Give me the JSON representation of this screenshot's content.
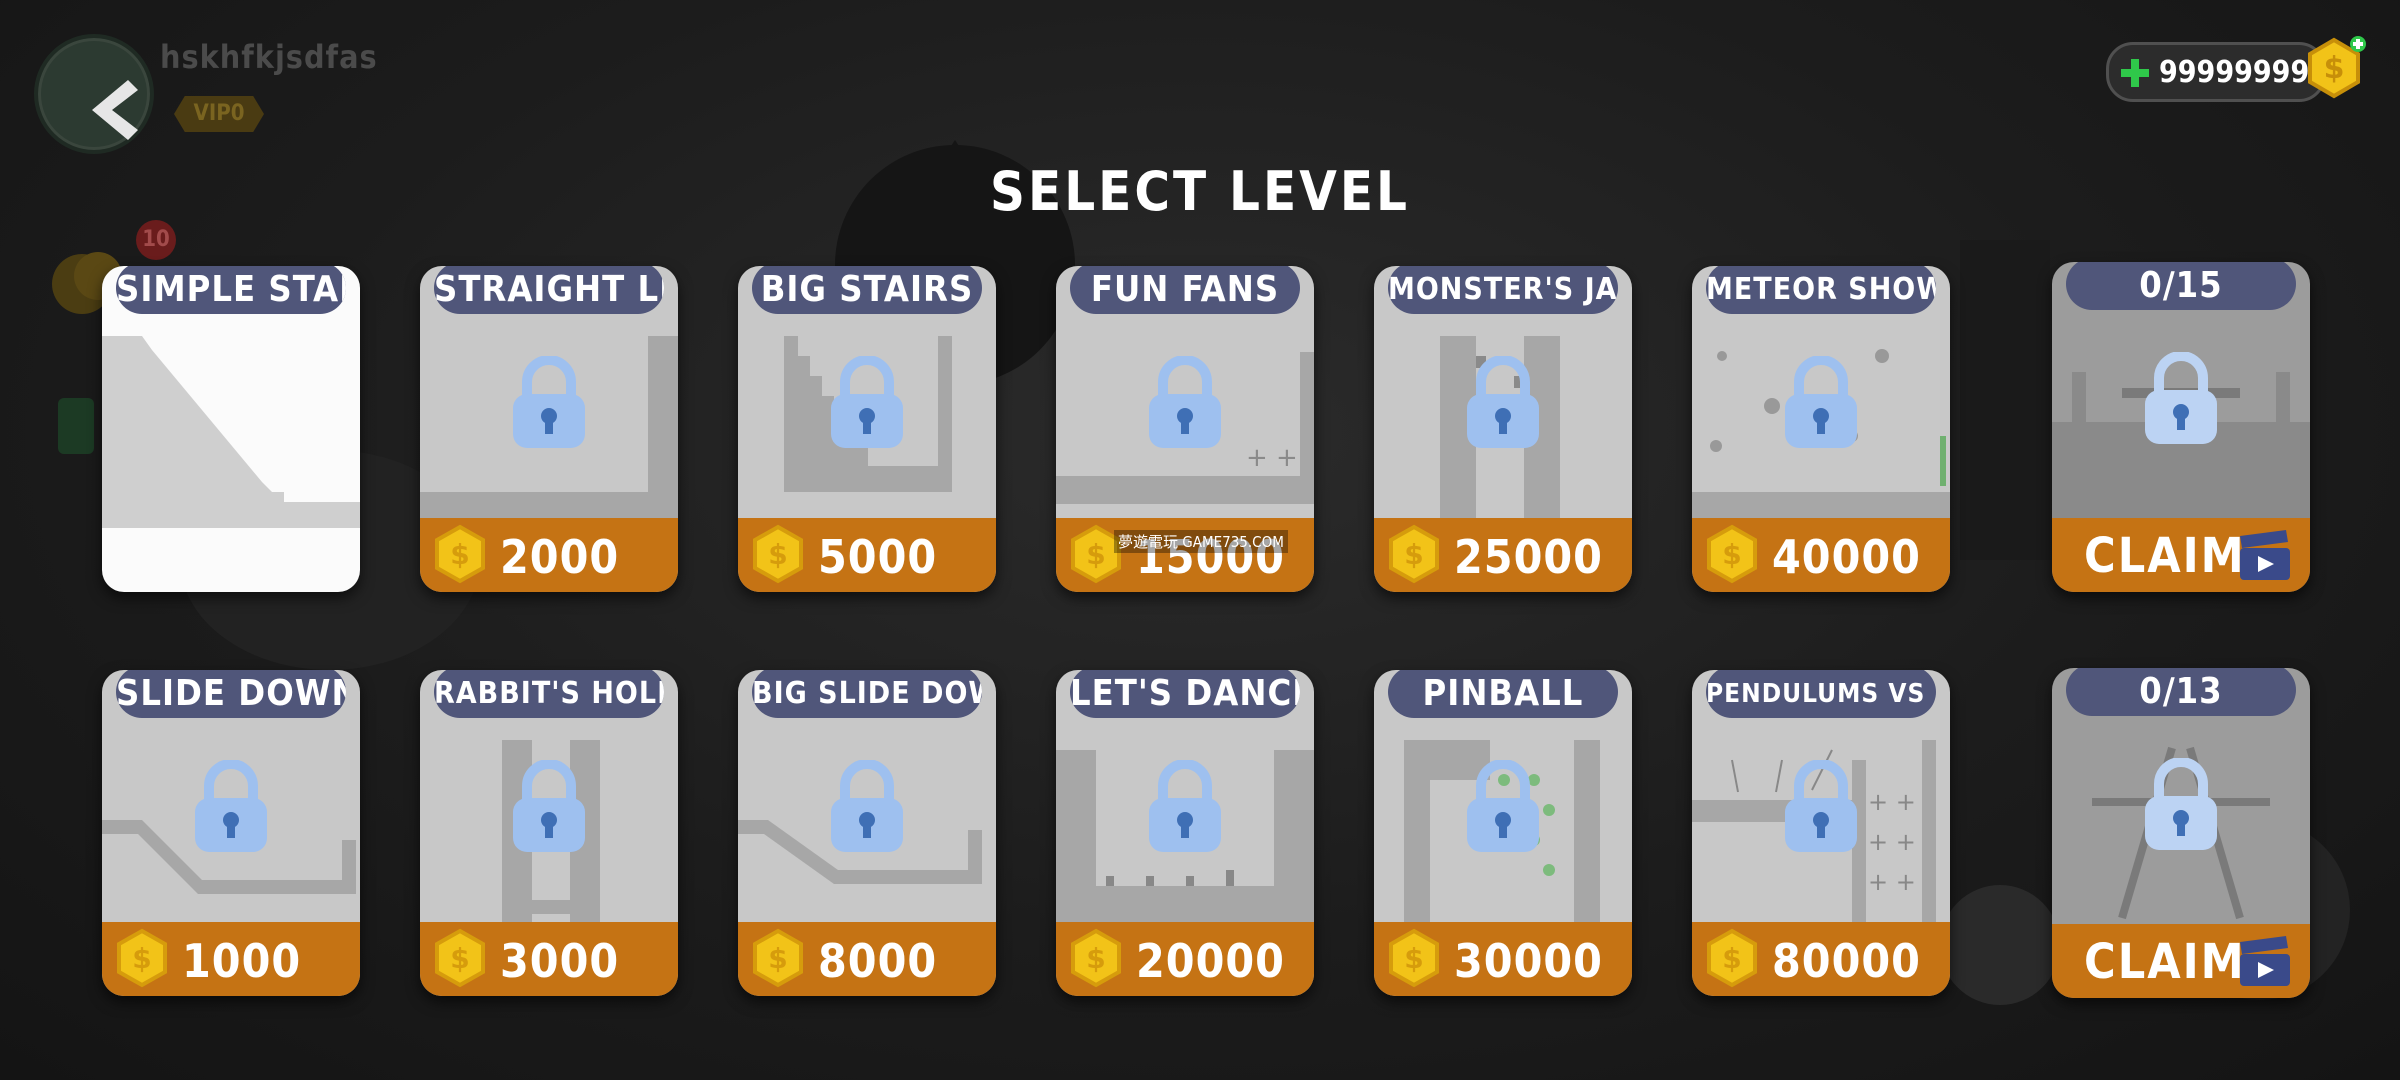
{
  "header": {
    "username": "hskhfkjsdfas",
    "vip": "VIP0",
    "notification_count": "10",
    "coin_balance": "999999999"
  },
  "title": "SELECT LEVEL",
  "watermark": "夢遊電玩 GAME735.COM",
  "levels_row1": [
    {
      "name": "SIMPLE STAIRS",
      "price": "",
      "locked": false
    },
    {
      "name": "STRAIGHT LINE",
      "price": "2000",
      "locked": true
    },
    {
      "name": "BIG STAIRS",
      "price": "5000",
      "locked": true
    },
    {
      "name": "FUN FANS",
      "price": "15000",
      "locked": true
    },
    {
      "name": "MONSTER'S JAWS",
      "price": "25000",
      "locked": true
    },
    {
      "name": "METEOR SHOWER",
      "price": "40000",
      "locked": true
    },
    {
      "name": "0/15",
      "price": "CLAIM",
      "locked": true
    }
  ],
  "levels_row2": [
    {
      "name": "SLIDE DOWN",
      "price": "1000",
      "locked": true
    },
    {
      "name": "RABBIT'S HOLE",
      "price": "3000",
      "locked": true
    },
    {
      "name": "BIG SLIDE DOWN",
      "price": "8000",
      "locked": true
    },
    {
      "name": "LET'S DANCE",
      "price": "20000",
      "locked": true
    },
    {
      "name": "PINBALL",
      "price": "30000",
      "locked": true
    },
    {
      "name": "PENDULUMS VS FANS",
      "price": "80000",
      "locked": true
    },
    {
      "name": "0/13",
      "price": "CLAIM",
      "locked": true
    }
  ],
  "colors": {
    "label_tab": "#50567a",
    "price_bar": "#c57314",
    "coin": "#f2c318",
    "lock": "#9ec0ef"
  }
}
